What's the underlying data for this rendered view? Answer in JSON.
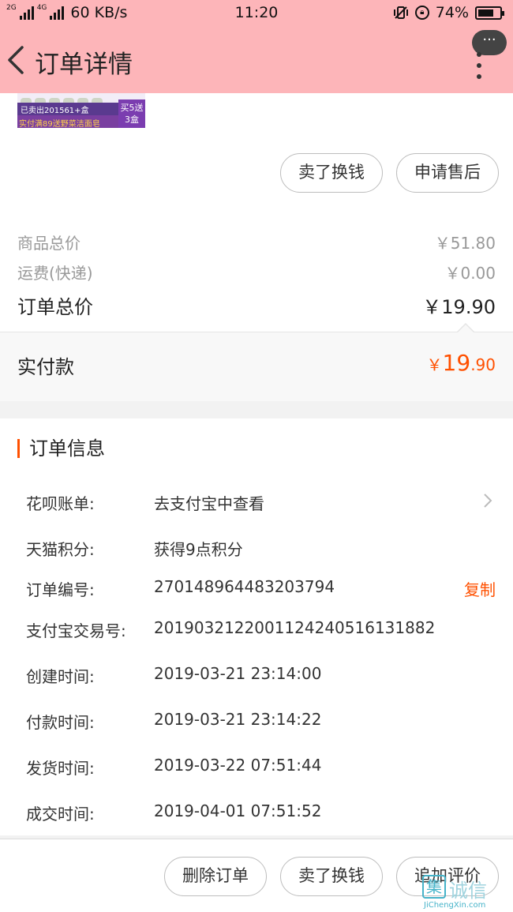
{
  "status_bar": {
    "net_small_1": "2G",
    "net_small_2": "4G",
    "speed": "60 KB/s",
    "time": "11:20",
    "battery": "74%",
    "battery_level": 0.74
  },
  "header": {
    "title": "订单详情",
    "more_label": "···"
  },
  "product": {
    "sold_text": "已卖出201561+盒",
    "promo_line": "实付满89送野菜洁面皂",
    "badge": "买5送3盒"
  },
  "top_actions": {
    "sell_label": "卖了换钱",
    "after_sale_label": "申请售后"
  },
  "prices": {
    "goods_total_label": "商品总价",
    "goods_total_value": "￥51.80",
    "shipping_label": "运费(快递)",
    "shipping_value": "￥0.00",
    "order_total_label": "订单总价",
    "order_total_value": "￥19.90",
    "paid_label": "实付款",
    "paid_currency": "￥",
    "paid_int": "19",
    "paid_dec": ".90"
  },
  "order_info": {
    "title": "订单信息",
    "rows": [
      {
        "label": "花呗账单:",
        "value": "去支付宝中查看"
      },
      {
        "label": "天猫积分:",
        "value": "获得9点积分"
      },
      {
        "label": "订单编号:",
        "value": "270148964483203794",
        "action": "复制"
      },
      {
        "label": "支付宝交易号:",
        "value": "2019032122001124240516131882"
      },
      {
        "label": "创建时间:",
        "value": "2019-03-21 23:14:00"
      },
      {
        "label": "付款时间:",
        "value": "2019-03-21 23:14:22"
      },
      {
        "label": "发货时间:",
        "value": "2019-03-22 07:51:44"
      },
      {
        "label": "成交时间:",
        "value": "2019-04-01 07:51:52"
      }
    ]
  },
  "bottom_actions": {
    "delete_label": "删除订单",
    "sell_label": "卖了换钱",
    "review_label": "追加评价"
  },
  "watermark": {
    "icon_char": "集",
    "cn": "诚信",
    "en": "JiChengXin.com"
  },
  "colors": {
    "header_bg": "#fdb5b9",
    "accent": "#ff5000"
  }
}
